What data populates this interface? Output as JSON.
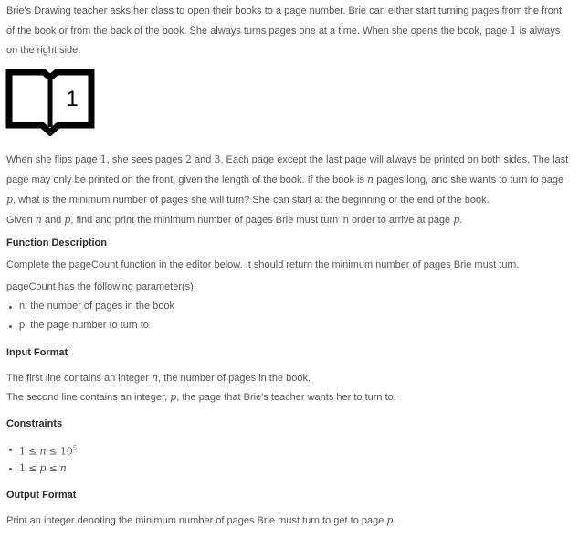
{
  "intro": {
    "text": "Brie's Drawing teacher asks her class to open their books to a page number. Brie can either start turning pages from the front of the book or from the back of the book. She always turns pages one at a time. When she opens the book, page ",
    "page_num": "1",
    "text_end": " is always on the right side:"
  },
  "illustration": {
    "page_label": "1"
  },
  "flip": {
    "p1": "When she flips page ",
    "n1": "1",
    "p2": ", she sees pages ",
    "n2": "2",
    "p3": " and ",
    "n3": "3",
    "p4": ". Each page except the last page will always be printed on both sides. The last page may only be printed on the front, given the length of the book. If the book is ",
    "v1": "n",
    "p5": " pages long, and she wants to turn to page ",
    "v2": "p",
    "p6": ", what is the minimum number of pages she will turn? She can start at the beginning or the end of the book."
  },
  "given": {
    "p1": "Given ",
    "v1": "n",
    "p2": " and ",
    "v2": "p",
    "p3": ", find and print the minimum number of pages Brie must turn in order to arrive at page ",
    "v3": "p",
    "p4": "."
  },
  "function_description": {
    "heading": "Function Description",
    "text": "Complete the pageCount function in the editor below. It should return the minimum number of pages Brie must turn.",
    "params_intro": "pageCount has the following parameter(s):",
    "params": [
      "n: the number of pages in the book",
      "p: the page number to turn to"
    ]
  },
  "input_format": {
    "heading": "Input Format",
    "line1_a": "The first line contains an integer ",
    "line1_v": "n",
    "line1_b": ", the number of pages in the book.",
    "line2_a": "The second line contains an integer, ",
    "line2_v": "p",
    "line2_b": ", the page that Brie's teacher wants her to turn to."
  },
  "constraints": {
    "heading": "Constraints",
    "c1": {
      "a": "1",
      "op1": "≤",
      "v": "n",
      "op2": "≤",
      "base": "10",
      "exp": "5"
    },
    "c2": {
      "a": "1",
      "op1": "≤",
      "v": "p",
      "op2": "≤",
      "b": "n"
    }
  },
  "output_format": {
    "heading": "Output Format",
    "text_a": "Print an integer denoting the minimum number of pages Brie must turn to get to page ",
    "v": "p",
    "text_b": "."
  }
}
